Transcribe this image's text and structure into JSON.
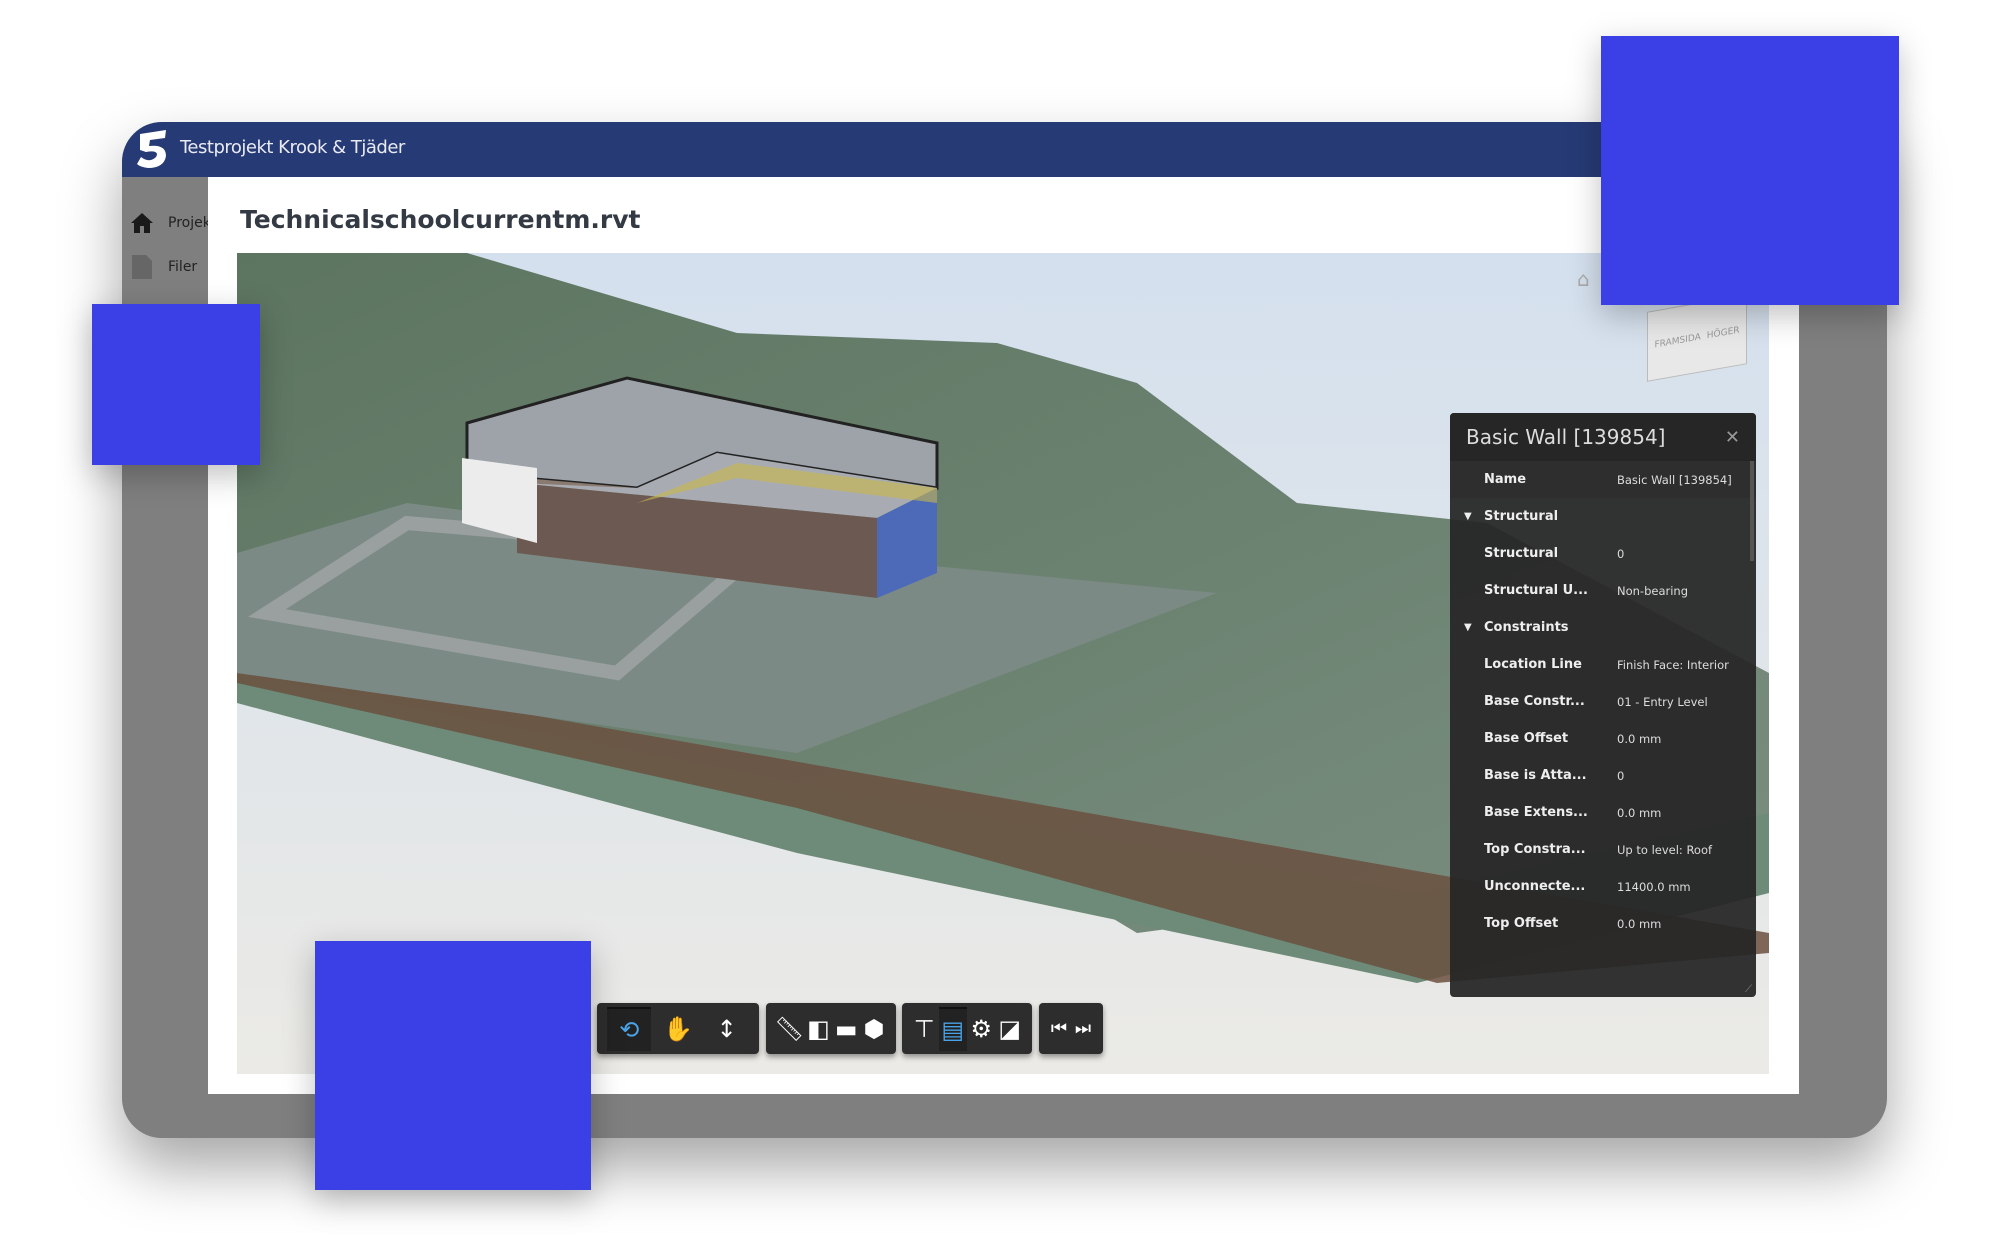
{
  "header": {
    "project_name": "Testprojekt Krook & Tjäder"
  },
  "sidebar": {
    "items": [
      {
        "label": "Projek",
        "icon": "home-icon"
      },
      {
        "label": "Filer",
        "icon": "file-icon"
      }
    ]
  },
  "main": {
    "title": "Technicalschoolcurrentm.rvt"
  },
  "viewcube": {
    "labels": [
      "FRAMSIDA",
      "HÖGER"
    ]
  },
  "properties": {
    "title": "Basic Wall [139854]",
    "rows": [
      {
        "type": "prop",
        "label": "Name",
        "value": "Basic Wall [139854]"
      },
      {
        "type": "section",
        "label": "Structural"
      },
      {
        "type": "prop",
        "label": "Structural",
        "value": "0"
      },
      {
        "type": "prop",
        "label": "Structural U...",
        "value": "Non-bearing"
      },
      {
        "type": "section",
        "label": "Constraints"
      },
      {
        "type": "prop",
        "label": "Location Line",
        "value": "Finish Face: Interior"
      },
      {
        "type": "prop",
        "label": "Base Constr...",
        "value": "01 - Entry Level"
      },
      {
        "type": "prop",
        "label": "Base Offset",
        "value": "0.0 mm"
      },
      {
        "type": "prop",
        "label": "Base is Atta...",
        "value": "0"
      },
      {
        "type": "prop",
        "label": "Base Extens...",
        "value": "0.0 mm"
      },
      {
        "type": "prop",
        "label": "Top Constra...",
        "value": "Up to level: Roof"
      },
      {
        "type": "prop",
        "label": "Unconnecte...",
        "value": "11400.0 mm"
      },
      {
        "type": "prop",
        "label": "Top Offset",
        "value": "0.0 mm"
      }
    ]
  },
  "toolbar": {
    "groups": [
      [
        "orbit-icon",
        "pan-icon",
        "zoom-icon",
        "first-person-icon",
        "camera-icon"
      ],
      [
        "measure-icon",
        "section-icon",
        "explode-icon",
        "model-icon"
      ],
      [
        "model-browser-icon",
        "properties-icon",
        "settings-icon",
        "fullscreen-icon"
      ],
      [
        "previous-icon",
        "next-icon"
      ]
    ],
    "active": [
      "orbit-icon",
      "properties-icon"
    ]
  },
  "colors": {
    "header": "#263a75",
    "accent_blue": "#3b40e6",
    "toolbar_active": "#4aa3e8"
  }
}
